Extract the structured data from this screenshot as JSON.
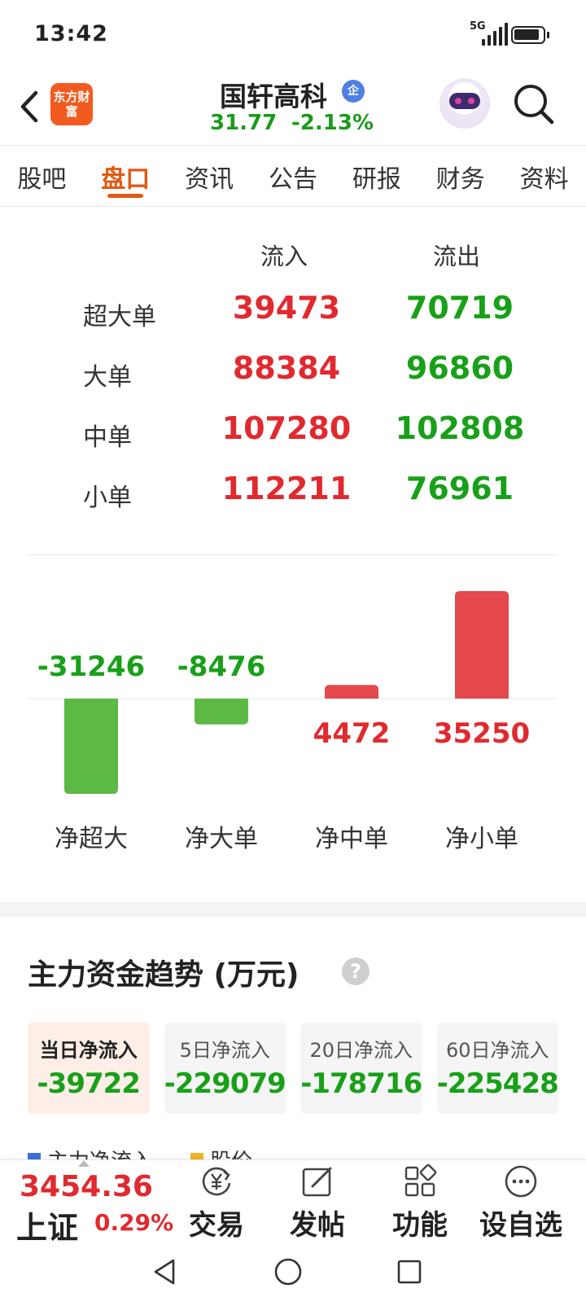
{
  "status": {
    "time": "13:42",
    "network": "5G"
  },
  "header": {
    "logo_text": "东方财富",
    "stock_name": "国轩高科",
    "badge": "企",
    "price": "31.77",
    "change_pct": "-2.13%"
  },
  "tabs": [
    "股吧",
    "盘口",
    "资讯",
    "公告",
    "研报",
    "财务",
    "资料"
  ],
  "active_tab": "盘口",
  "flow_table": {
    "headers": {
      "in": "流入",
      "out": "流出"
    },
    "rows": [
      {
        "label": "超大单",
        "in": "39473",
        "out": "70719"
      },
      {
        "label": "大单",
        "in": "88384",
        "out": "96860"
      },
      {
        "label": "中单",
        "in": "107280",
        "out": "102808"
      },
      {
        "label": "小单",
        "in": "112211",
        "out": "76961"
      }
    ]
  },
  "chart_data": {
    "type": "bar",
    "categories": [
      "净超大",
      "净大单",
      "净中单",
      "净小单"
    ],
    "values": [
      -31246,
      -8476,
      4472,
      35250
    ],
    "value_labels": [
      "-31246",
      "-8476",
      "4472",
      "35250"
    ],
    "colors": {
      "positive": "#e5484d",
      "negative": "#5bb944"
    }
  },
  "trend": {
    "title": "主力资金趋势 (万元)",
    "help": "?",
    "cards": [
      {
        "label": "当日净流入",
        "value": "-39722"
      },
      {
        "label": "5日净流入",
        "value": "-229079"
      },
      {
        "label": "20日净流入",
        "value": "-178716"
      },
      {
        "label": "60日净流入",
        "value": "-225428"
      }
    ],
    "legend": [
      {
        "label": "主力净流入",
        "color": "#3b6fe0"
      },
      {
        "label": "股价",
        "color": "#f0b528"
      }
    ]
  },
  "bottom_bar": {
    "index_value": "3454.36",
    "index_name": "上证",
    "index_pct": "0.29%",
    "buttons": [
      {
        "label": "交易",
        "icon": "yen-exchange-icon"
      },
      {
        "label": "发帖",
        "icon": "edit-icon"
      },
      {
        "label": "功能",
        "icon": "grid-apps-icon"
      },
      {
        "label": "设自选",
        "icon": "more-dots-icon"
      }
    ]
  }
}
